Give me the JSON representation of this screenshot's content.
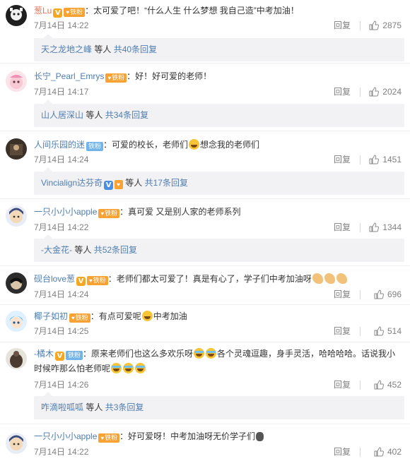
{
  "comments": [
    {
      "user": "葱Lu",
      "badge_v": "V",
      "fan_badge": "铁粉",
      "text": "：太可爱了吧！“什么人生 什么梦想 我自己造”中考加油！",
      "time": "7月14日 14:22",
      "reply_label": "回复",
      "likes": "2875",
      "replies": {
        "from": "天之龙地之峰",
        "mid": "等人",
        "count": "共40条回复"
      }
    },
    {
      "user": "长宁_Pearl_Emrys",
      "fan_badge": "铁粉",
      "text": "：好！好可爱的老师！",
      "time": "7月14日 14:17",
      "reply_label": "回复",
      "likes": "2024",
      "replies": {
        "from": "山人居深山",
        "mid": "等人",
        "count": "共34条回复"
      }
    },
    {
      "user": "人间乐园的迷",
      "fan_badge": "铁粉",
      "text_a": "：可爱的校长，老师们",
      "text_b": "想念我的老师们",
      "time": "7月14日 14:24",
      "reply_label": "回复",
      "likes": "1451",
      "replies": {
        "from": "Vincialign达芬奇",
        "mid": "等人",
        "count": "共17条回复"
      }
    },
    {
      "user": "一只小小小apple",
      "fan_badge": "铁粉",
      "text": "：真可爱 又是别人家的老师系列",
      "time": "7月14日 14:22",
      "reply_label": "回复",
      "likes": "1344",
      "replies": {
        "from": "-大金花-",
        "mid": "等人",
        "count": "共52条回复"
      }
    },
    {
      "user": "砚台love葱",
      "badge_v": "V",
      "fan_badge": "铁粉",
      "text": "：老师们都太可爱了！真是有心了，学子们中考加油呀",
      "time": "7月14日 14:24",
      "reply_label": "回复",
      "likes": "696"
    },
    {
      "user": "椰子如初",
      "fan_badge": "铁粉",
      "text_a": "：有点可爱呢",
      "text_b": "中考加油",
      "time": "7月14日 14:25",
      "reply_label": "回复",
      "likes": "514"
    },
    {
      "user": "-橘木",
      "badge_v": "V",
      "fan_badge": "铁粉",
      "text_a": "：原来老师们也这么多欢乐呀",
      "text_b": "各个灵魂逗趣，身手灵活，哈哈哈哈。话说我小",
      "text_c": "时候咋那么怕老师呢",
      "time": "7月14日 14:26",
      "reply_label": "回复",
      "likes": "452",
      "replies": {
        "from": "咋滴啦呱呱",
        "mid": "等人",
        "count": "共3条回复"
      }
    },
    {
      "user": "一只小小小apple",
      "fan_badge": "铁粉",
      "text": "：好可爱呀！中考加油呀无价学子们",
      "time": "7月14日 14:22",
      "reply_label": "回复",
      "likes": "402"
    }
  ],
  "colors": {
    "username": "#eb7350",
    "link": "#507daf",
    "meta": "#808080",
    "reply_bg": "#f2f2f5"
  },
  "icons": {
    "like": "thumbs-up-icon",
    "face": "emoji-face-icon"
  }
}
